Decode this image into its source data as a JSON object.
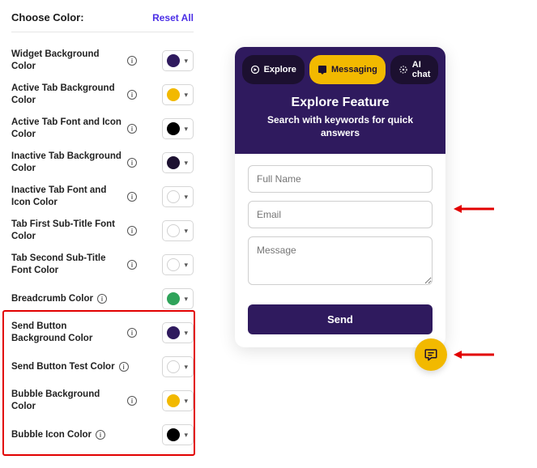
{
  "header": {
    "title": "Choose Color:",
    "reset": "Reset All"
  },
  "rows": [
    {
      "label": "Widget Background Color",
      "color": "#2f1a5e",
      "hollow": false
    },
    {
      "label": "Active Tab Background Color",
      "color": "#f2b900",
      "hollow": false
    },
    {
      "label": "Active Tab Font and Icon Color",
      "color": "#000000",
      "hollow": false
    },
    {
      "label": "Inactive Tab Background Color",
      "color": "#1c1030",
      "hollow": false
    },
    {
      "label": "Inactive Tab Font and Icon Color",
      "color": "#ffffff",
      "hollow": true
    },
    {
      "label": "Tab First Sub-Title Font Color",
      "color": "#ffffff",
      "hollow": true
    },
    {
      "label": "Tab Second Sub-Title Font Color",
      "color": "#ffffff",
      "hollow": true
    },
    {
      "label": "Breadcrumb Color",
      "color": "#2fa35a",
      "hollow": false
    },
    {
      "label": "Send Button Background Color",
      "color": "#2f1a5e",
      "hollow": false
    },
    {
      "label": "Send Button Test Color",
      "color": "#ffffff",
      "hollow": true
    },
    {
      "label": "Bubble Background Color",
      "color": "#f2b900",
      "hollow": false
    },
    {
      "label": "Bubble Icon Color",
      "color": "#000000",
      "hollow": false
    }
  ],
  "preview": {
    "tabs": [
      {
        "label": "Explore",
        "active": false
      },
      {
        "label": "Messaging",
        "active": true
      },
      {
        "label": "AI chat",
        "active": false
      }
    ],
    "title": "Explore Feature",
    "subtitle": "Search with keywords for quick answers",
    "placeholders": {
      "name": "Full Name",
      "email": "Email",
      "message": "Message"
    },
    "send": "Send"
  }
}
